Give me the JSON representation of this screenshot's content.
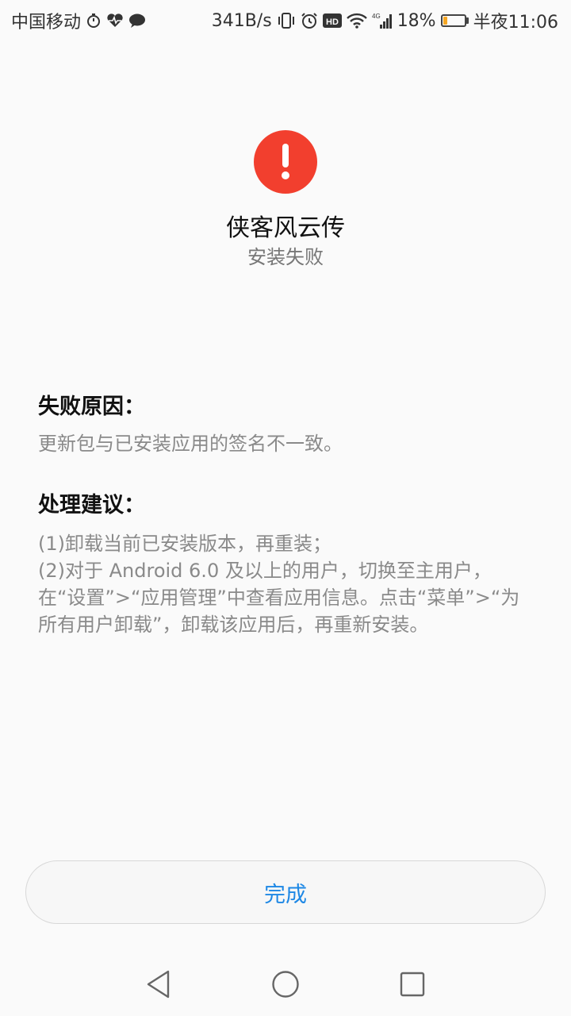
{
  "status_bar": {
    "carrier": "中国移动",
    "net_speed": "341B/s",
    "hd_badge": "HD",
    "network_type": "4G",
    "battery_percent": "18%",
    "battery_level": 0.18,
    "time": "半夜11:06",
    "icons": [
      "stopwatch-icon",
      "heart-rate-icon",
      "chat-icon",
      "vibrate-icon",
      "alarm-icon",
      "hd-icon",
      "wifi-icon",
      "signal-icon",
      "battery-icon"
    ]
  },
  "header": {
    "alert_icon": "exclamation-icon",
    "alert_color": "#f23f2e",
    "app_name": "侠客风云传",
    "status": "安装失败"
  },
  "reason": {
    "title": "失败原因：",
    "text": "更新包与已安装应用的签名不一致。"
  },
  "advice": {
    "title": "处理建议：",
    "lines": [
      "(1)卸载当前已安装版本，再重装；",
      "(2)对于 Android 6.0 及以上的用户，切换至主用户，",
      "在“设置”>“应用管理”中查看应用信息。点击“菜单”>“为",
      "所有用户卸载”，卸载该应用后，再重新安装。"
    ]
  },
  "actions": {
    "done_label": "完成",
    "accent_color": "#1e88e5"
  },
  "nav_bar": {
    "back_icon": "back-triangle-icon",
    "home_icon": "home-circle-icon",
    "recent_icon": "recent-square-icon"
  }
}
